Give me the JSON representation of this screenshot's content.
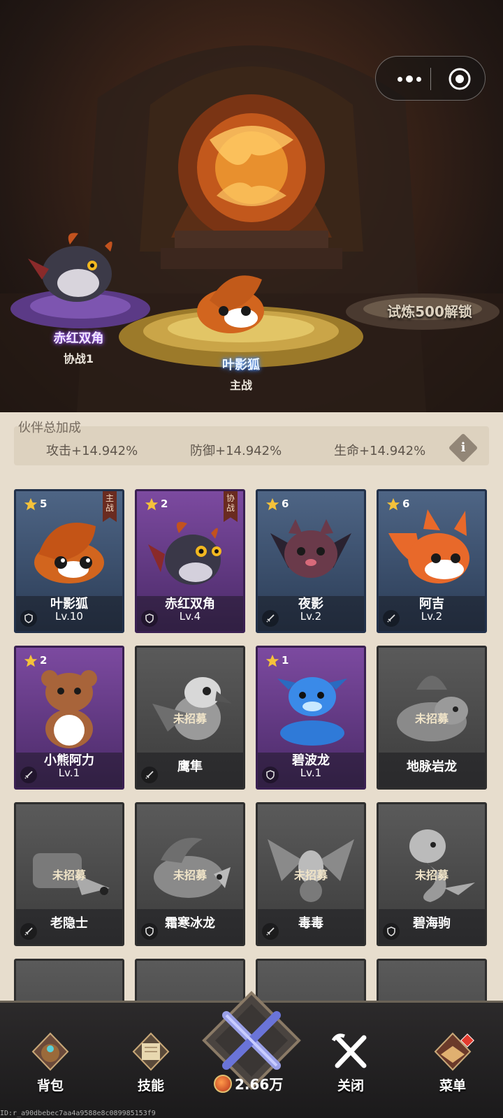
{
  "scene": {
    "locked_slot_text": "试炼500解锁",
    "assist_pet": {
      "name": "赤红双角",
      "role": "协战1"
    },
    "main_pet": {
      "name": "叶影狐",
      "role": "主战"
    }
  },
  "bonus": {
    "title": "伙伴总加成",
    "attack": "攻击+14.942%",
    "defense": "防御+14.942%",
    "hp": "生命+14.942%",
    "info_icon": "i"
  },
  "pets": [
    {
      "name": "叶影狐",
      "level": "Lv.10",
      "stars": "5",
      "tag": "主战",
      "rarity": "blue"
    },
    {
      "name": "赤红双角",
      "level": "Lv.4",
      "stars": "2",
      "tag": "协战",
      "rarity": "purple"
    },
    {
      "name": "夜影",
      "level": "Lv.2",
      "stars": "6",
      "rarity": "blue"
    },
    {
      "name": "阿吉",
      "level": "Lv.2",
      "stars": "6",
      "rarity": "blue"
    },
    {
      "name": "小熊阿力",
      "level": "Lv.1",
      "stars": "2",
      "rarity": "purple"
    },
    {
      "name": "鹰隼",
      "status": "未招募",
      "rarity": "gray"
    },
    {
      "name": "碧波龙",
      "level": "Lv.1",
      "stars": "1",
      "rarity": "purple"
    },
    {
      "name": "地脉岩龙",
      "status": "未招募",
      "rarity": "gray"
    },
    {
      "name": "老隐士",
      "status": "未招募",
      "rarity": "gray"
    },
    {
      "name": "霜寒冰龙",
      "status": "未招募",
      "rarity": "gray"
    },
    {
      "name": "毒毒",
      "status": "未招募",
      "rarity": "gray"
    },
    {
      "name": "碧海驹",
      "status": "未招募",
      "rarity": "gray"
    }
  ],
  "nav": {
    "bag": "背包",
    "skills": "技能",
    "currency": "2.66万",
    "close": "关闭",
    "menu": "菜单"
  },
  "footer_id": "ID:r_a90dbebec7aa4a9588e8c089985153f9"
}
